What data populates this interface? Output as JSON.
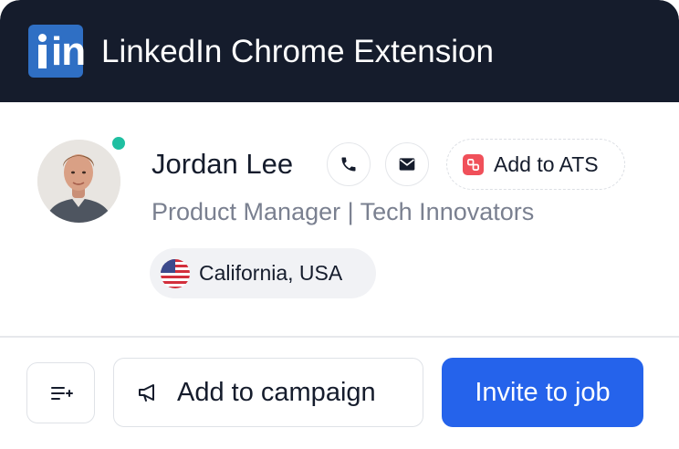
{
  "header": {
    "logo_text": "in",
    "title": "LinkedIn Chrome Extension"
  },
  "profile": {
    "name": "Jordan Lee",
    "headline": "Product Manager | Tech Innovators",
    "status": "online",
    "location": "California, USA",
    "location_flag": "us-flag-icon"
  },
  "actions": {
    "call_icon": "phone-icon",
    "email_icon": "mail-icon",
    "ats_label": "Add to ATS",
    "campaign_label": "Add to campaign",
    "invite_label": "Invite to job",
    "list_icon": "list-add-icon"
  },
  "colors": {
    "header_bg": "#151c2c",
    "linkedin_blue": "#2f6fc4",
    "primary": "#2563eb",
    "online": "#1fbfa1",
    "ats_brand": "#f0505a"
  }
}
